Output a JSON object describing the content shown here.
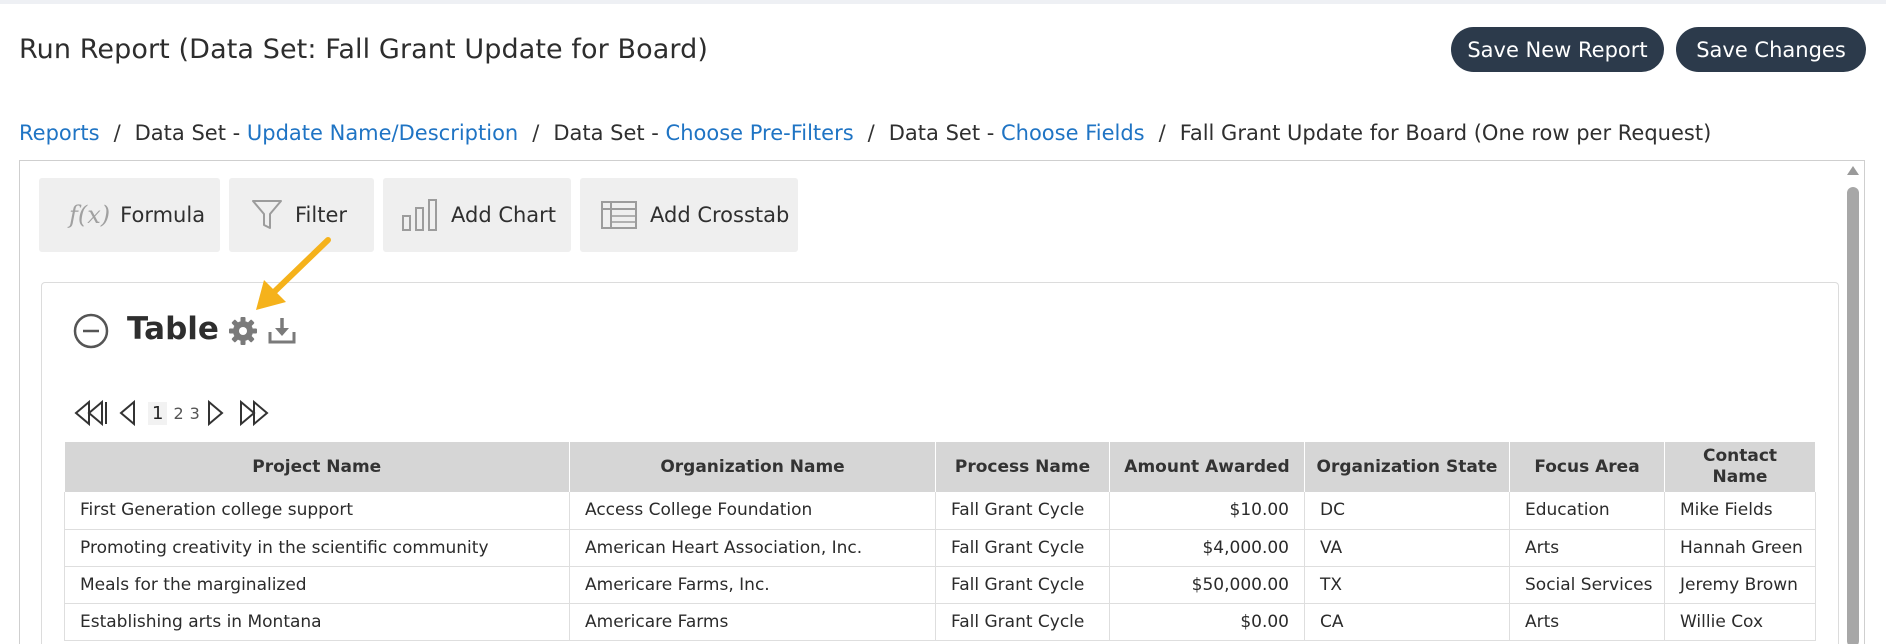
{
  "header": {
    "title": "Run Report (Data Set: Fall Grant Update for Board)",
    "save_new_label": "Save New Report",
    "save_changes_label": "Save Changes"
  },
  "breadcrumb": {
    "reports": "Reports",
    "sep": "/",
    "ds_prefix": "Data Set - ",
    "update_name": "Update Name/Description",
    "pre_filters": "Choose Pre-Filters",
    "choose_fields": "Choose Fields",
    "current": "Fall Grant Update for Board (One row per Request)"
  },
  "toolbar": {
    "formula_icon": "f(x)",
    "formula_label": "Formula",
    "filter_label": "Filter",
    "add_chart_label": "Add Chart",
    "add_crosstab_label": "Add Crosstab"
  },
  "table_section": {
    "title": "Table",
    "pager": {
      "pages": [
        "1",
        "2",
        "3"
      ],
      "current": "1"
    },
    "columns": [
      "Project Name",
      "Organization Name",
      "Process Name",
      "Amount Awarded",
      "Organization State",
      "Focus Area",
      "Contact Name"
    ],
    "rows": [
      [
        "First Generation college support",
        "Access College Foundation",
        "Fall Grant Cycle",
        "$10.00",
        "DC",
        "Education",
        "Mike Fields"
      ],
      [
        "Promoting creativity in the scientific community",
        "American Heart Association, Inc.",
        "Fall Grant Cycle",
        "$4,000.00",
        "VA",
        "Arts",
        "Hannah Green"
      ],
      [
        "Meals for the marginalized",
        "Americare Farms, Inc.",
        "Fall Grant Cycle",
        "$50,000.00",
        "TX",
        "Social Services",
        "Jeremy Brown"
      ],
      [
        "Establishing arts in Montana",
        "Americare Farms",
        "Fall Grant Cycle",
        "$0.00",
        "CA",
        "Arts",
        "Willie Cox"
      ]
    ]
  },
  "colors": {
    "accent_link": "#1f74c4",
    "header_button": "#2c3a4b",
    "annotation_arrow": "#f5b21b",
    "table_header_bg": "#d6d6d6"
  }
}
